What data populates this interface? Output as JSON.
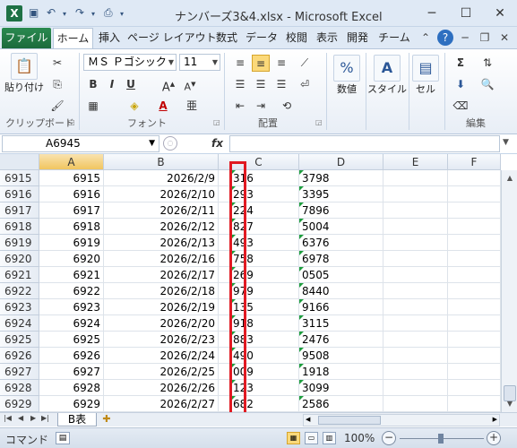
{
  "window": {
    "title": "ナンバーズ3&4.xlsx  -  Microsoft Excel",
    "app_icon_letter": "X",
    "undo_glyph": "↶",
    "redo_glyph": "↷",
    "minimize": "─",
    "maximize": "☐",
    "close": "✕"
  },
  "ribbon_tabs": [
    "ファイル",
    "ホーム",
    "挿入",
    "ページ レイアウト",
    "数式",
    "データ",
    "校閲",
    "表示",
    "開発",
    "チーム"
  ],
  "ribbon": {
    "clipboard": {
      "paste": "貼り付け",
      "label": "クリップボード"
    },
    "font": {
      "name": "ＭＳ Ｐゴシック",
      "size": "11",
      "label": "フォント"
    },
    "alignment": {
      "label": "配置"
    },
    "number": {
      "button": "数値",
      "symbol": "%"
    },
    "styles": {
      "button": "スタイル"
    },
    "cells": {
      "button": "セル"
    },
    "editing": {
      "label": "編集"
    }
  },
  "formula_bar": {
    "name_box": "A6945",
    "fx": "fx",
    "formula": ""
  },
  "columns": [
    "A",
    "B",
    "C",
    "D",
    "E",
    "F"
  ],
  "rows": [
    {
      "row": "6915",
      "a": "6915",
      "b": "2026/2/9",
      "c": "316",
      "d": "3798"
    },
    {
      "row": "6916",
      "a": "6916",
      "b": "2026/2/10",
      "c": "293",
      "d": "3395"
    },
    {
      "row": "6917",
      "a": "6917",
      "b": "2026/2/11",
      "c": "224",
      "d": "7896"
    },
    {
      "row": "6918",
      "a": "6918",
      "b": "2026/2/12",
      "c": "827",
      "d": "5004"
    },
    {
      "row": "6919",
      "a": "6919",
      "b": "2026/2/13",
      "c": "493",
      "d": "6376"
    },
    {
      "row": "6920",
      "a": "6920",
      "b": "2026/2/16",
      "c": "758",
      "d": "6978"
    },
    {
      "row": "6921",
      "a": "6921",
      "b": "2026/2/17",
      "c": "269",
      "d": "0505"
    },
    {
      "row": "6922",
      "a": "6922",
      "b": "2026/2/18",
      "c": "979",
      "d": "8440"
    },
    {
      "row": "6923",
      "a": "6923",
      "b": "2026/2/19",
      "c": "135",
      "d": "9166"
    },
    {
      "row": "6924",
      "a": "6924",
      "b": "2026/2/20",
      "c": "918",
      "d": "3115"
    },
    {
      "row": "6925",
      "a": "6925",
      "b": "2026/2/23",
      "c": "883",
      "d": "2476"
    },
    {
      "row": "6926",
      "a": "6926",
      "b": "2026/2/24",
      "c": "490",
      "d": "9508"
    },
    {
      "row": "6927",
      "a": "6927",
      "b": "2026/2/25",
      "c": "009",
      "d": "1918"
    },
    {
      "row": "6928",
      "a": "6928",
      "b": "2026/2/26",
      "c": "123",
      "d": "3099"
    },
    {
      "row": "6929",
      "a": "6929",
      "b": "2026/2/27",
      "c": "682",
      "d": "2586"
    }
  ],
  "sheet_tabs": [
    "B表"
  ],
  "status": {
    "mode": "コマンド",
    "zoom": "100%"
  },
  "colors": {
    "highlight_border": "#e01a22",
    "file_tab": "#217346",
    "text_triangle": "#1e9e3e"
  }
}
